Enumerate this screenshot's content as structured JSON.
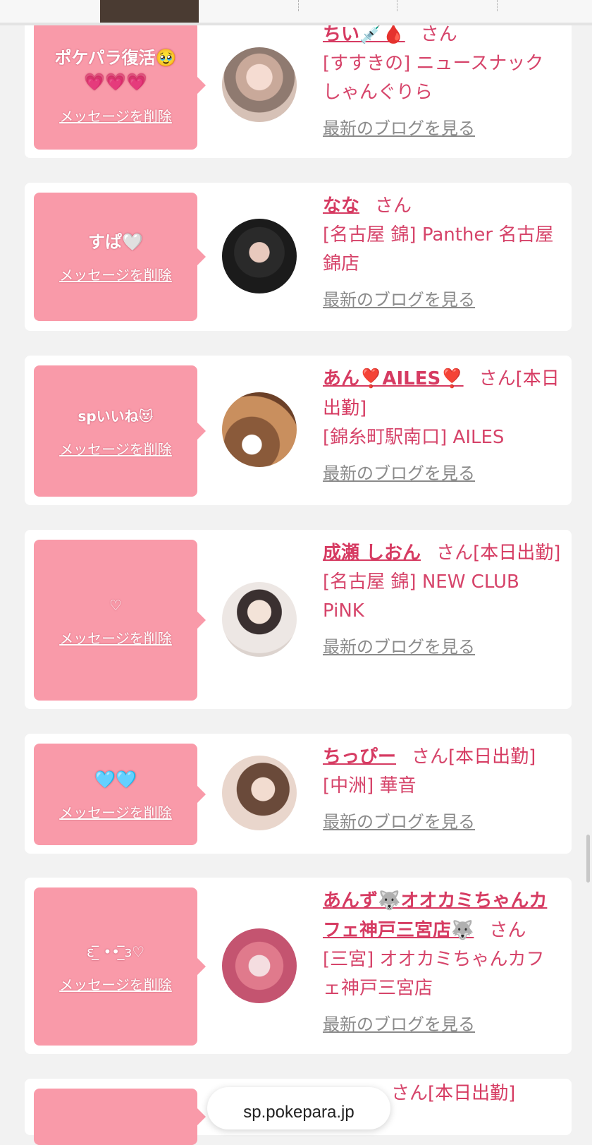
{
  "browser": {
    "url": "sp.pokepara.jp"
  },
  "labels": {
    "delete": "メッセージを削除",
    "blog": "最新のブログを見る",
    "suffix": "さん"
  },
  "cards": [
    {
      "message": "ポケパラ復活🥹💗💗💗",
      "name": "ちい💉🩸",
      "status": "",
      "shop": "[すすきの] ニュースナック しゃんぐりら"
    },
    {
      "message": "すぱ🤍",
      "name": "なな",
      "status": "",
      "shop": "[名古屋 錦] Panther 名古屋錦店"
    },
    {
      "message": "spいいね😻",
      "name": "あん❣️AILES❣️",
      "status": "[本日出勤]",
      "shop": "[錦糸町駅南口] AILES"
    },
    {
      "message": "♡",
      "name": "成瀬 しおん",
      "status": "[本日出勤]",
      "shop": "[名古屋 錦] NEW CLUB PiNK"
    },
    {
      "message": "🩵🩵",
      "name": "ちっぴー",
      "status": "[本日出勤]",
      "shop": "[中洲] 華音"
    },
    {
      "message": "ɛ ̲̅ •• ̲̅ɜ♡",
      "name": "あんず🐺オオカミちゃんカフェ神戸三宮店🐺",
      "status": "",
      "shop": "[三宮] オオカミちゃんカフェ神戸三宮店"
    },
    {
      "message": "",
      "name": "",
      "status": "[本日出勤]",
      "shop": ""
    }
  ]
}
